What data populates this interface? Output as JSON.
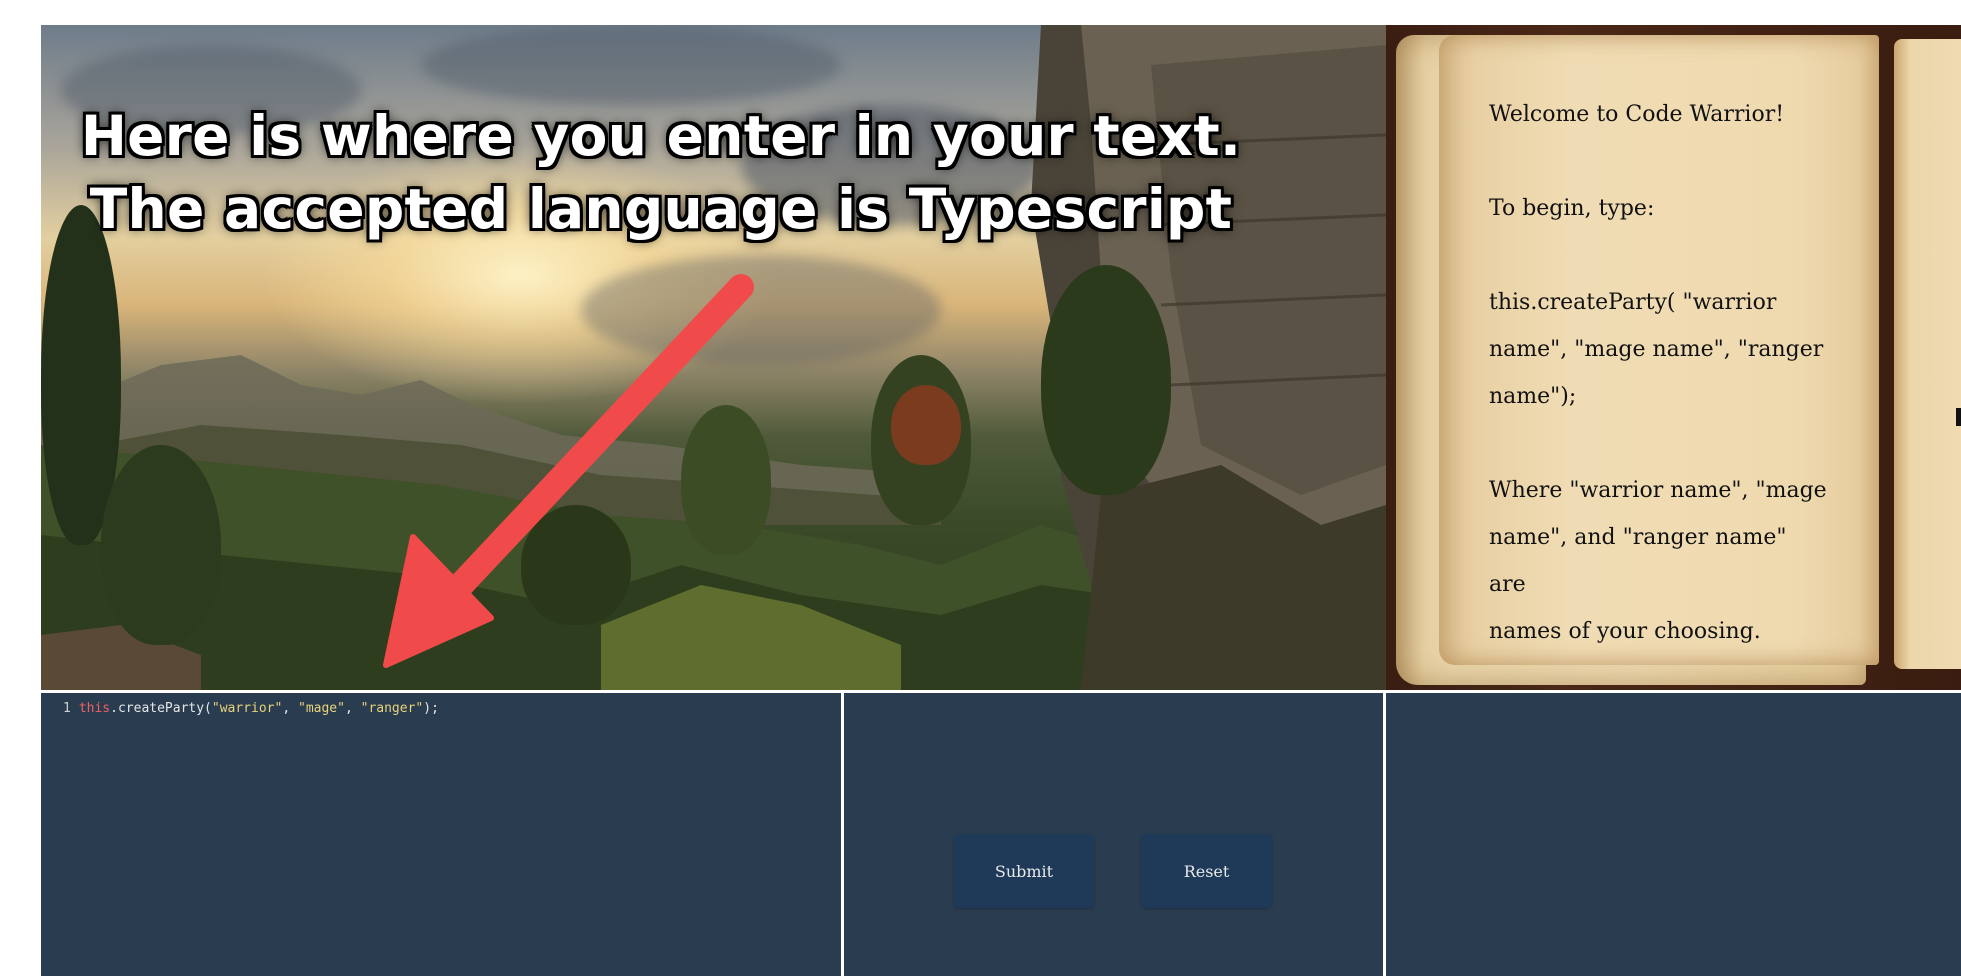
{
  "overlay": {
    "line1": "Here is where you enter in your text.",
    "line2": "The accepted language is Typescript"
  },
  "book": {
    "lines": [
      "Welcome to Code Warrior!",
      "",
      "To begin, type:",
      "",
      "this.createParty( \"warrior",
      "name\", \"mage name\", \"ranger",
      "name\");",
      "",
      "Where \"warrior name\", \"mage",
      "name\", and \"ranger name\" are",
      "names of your choosing."
    ]
  },
  "editor": {
    "line_number": "1",
    "keyword": "this",
    "call": ".createParty(",
    "arg1": "\"warrior\"",
    "sep1": ", ",
    "arg2": "\"mage\"",
    "sep2": ", ",
    "arg3": "\"ranger\"",
    "end": ");"
  },
  "controls": {
    "submit_label": "Submit",
    "reset_label": "Reset"
  },
  "colors": {
    "panel_bg": "#2a3d50",
    "button_bg": "#1f3a58",
    "arrow": "#f04a4a",
    "keyword": "#f06060",
    "string": "#e8d27a"
  }
}
